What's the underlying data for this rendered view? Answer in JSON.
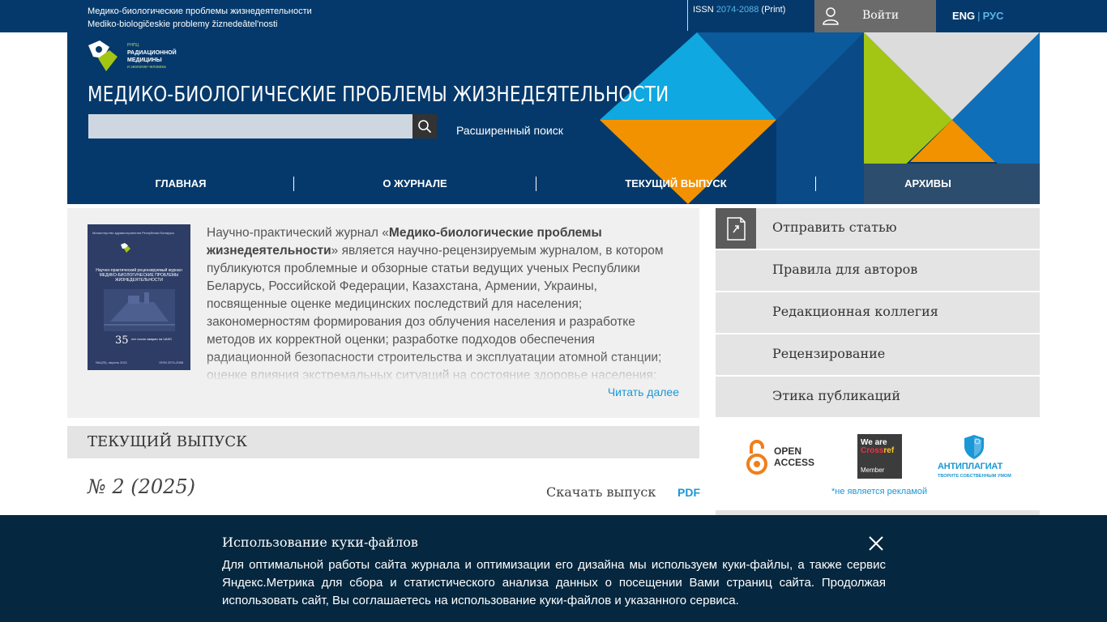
{
  "topbar": {
    "journal_ru": "Медико-биологические проблемы жизнедеятельности",
    "journal_translit": "Mediko-biologičeskie problemy žiznedeâtel'nosti",
    "issn_label": "ISSN",
    "issn_number": "2074-2088",
    "issn_type": "(Print)",
    "login_label": "Войти",
    "lang_en": "ENG",
    "lang_sep": "|",
    "lang_ru": "РУС"
  },
  "logo": {
    "line1": "РНПЦ",
    "line2": "РАДИАЦИОННОЙ",
    "line3": "МЕДИЦИНЫ",
    "line4": "и экологии человека"
  },
  "header": {
    "title": "МЕДИКО-БИОЛОГИЧЕСКИЕ ПРОБЛЕМЫ ЖИЗНЕДЕЯТЕЛЬНОСТИ",
    "search_placeholder": "",
    "advanced_search": "Расширенный поиск"
  },
  "nav": {
    "home": "ГЛАВНАЯ",
    "about": "О ЖУРНАЛЕ",
    "current": "ТЕКУЩИЙ ВЫПУСК",
    "archives": "АРХИВЫ"
  },
  "cover": {
    "ministry": "Министерство здравоохранения Республики Беларусь",
    "subtitle": "Научно-практический рецензируемый журнал",
    "title": "МЕДИКО-БИОЛОГИЧЕСКИЕ ПРОБЛЕМЫ ЖИЗНЕДЕЯТЕЛЬНОСТИ",
    "anniv_num": "35",
    "anniv_text": "лет после аварии на ЧАЭС",
    "issue": "№1(25), апрель 2021",
    "issn": "ISSN 2074-2088"
  },
  "about": {
    "intro": "Научно-практический журнал «",
    "name": "Медико-биологические проблемы жизнедеятельности",
    "rest": "» является научно-рецензируемым журналом, в котором публикуются проблемные и обзорные статьи ведущих ученых Республики Беларусь, Российской Федерации, Казахстана, Армении, Украины, посвященные оценке медицинских последствий для населения; закономерностям формирования доз облучения населения и разработке методов их корректной оценки; разработке подходов обеспечения радиационной безопасности строительства и эксплуатации атомной станции; оценке влияния экстремальных ситуаций на состояние здоровье населения;",
    "read_more": "Читать далее"
  },
  "current_issue": {
    "heading": "ТЕКУЩИЙ ВЫПУСК",
    "number": "№ 2 (2025)",
    "download_label": "Скачать выпуск",
    "pdf_label": "PDF"
  },
  "sidebar": {
    "items": [
      {
        "label": "Отправить статью"
      },
      {
        "label": "Правила для авторов"
      },
      {
        "label": "Редакционная коллегия"
      },
      {
        "label": "Рецензирование"
      },
      {
        "label": "Этика публикаций"
      }
    ],
    "open_access_line1": "OPEN",
    "open_access_line2": "ACCESS",
    "crossref_line1": "We are",
    "crossref_line2a": "Cross",
    "crossref_line2b": "ref",
    "crossref_line3": "Member",
    "antiplagiat_title": "АНТИПЛАГИАТ",
    "antiplagiat_slogan": "ТВОРИТЕ СОБСТВЕННЫМ УМОМ",
    "not_ad": "*не является рекламой"
  },
  "cookie": {
    "title": "Использование куки-файлов",
    "text": "Для оптимальной работы сайта журнала и оптимизации его дизайна мы используем куки-файлы, а также сервис Яндекс.Метрика для сбора и статистического анализа данных о посещении Вами страниц сайта. Продолжая использовать сайт, Вы соглашаетесь на использование куки-файлов и указанного сервиса."
  },
  "colors": {
    "navy": "#05396b",
    "accent_blue": "#1a98d5",
    "orange": "#f39200",
    "green": "#a3c614",
    "light_blue": "#0fa8e0",
    "cookie_bg": "#05273f"
  }
}
